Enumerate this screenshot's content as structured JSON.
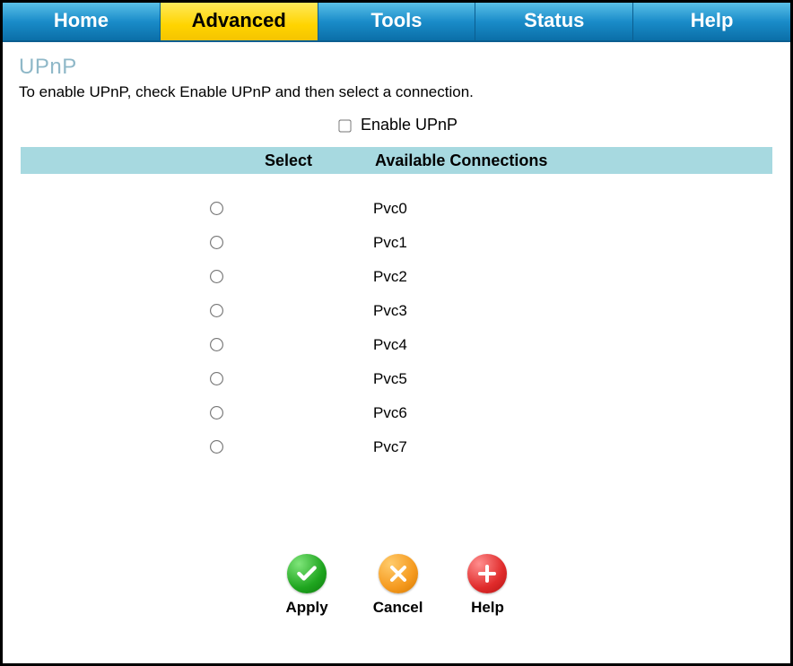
{
  "tabs": [
    {
      "label": "Home",
      "active": false
    },
    {
      "label": "Advanced",
      "active": true
    },
    {
      "label": "Tools",
      "active": false
    },
    {
      "label": "Status",
      "active": false
    },
    {
      "label": "Help",
      "active": false
    }
  ],
  "page": {
    "title": "UPnP",
    "description": "To enable UPnP, check Enable UPnP and then select a connection.",
    "enable_label": "Enable UPnP",
    "enable_checked": false
  },
  "table": {
    "header_select": "Select",
    "header_conn": "Available Connections",
    "rows": [
      {
        "name": "Pvc0",
        "selected": false
      },
      {
        "name": "Pvc1",
        "selected": false
      },
      {
        "name": "Pvc2",
        "selected": false
      },
      {
        "name": "Pvc3",
        "selected": false
      },
      {
        "name": "Pvc4",
        "selected": false
      },
      {
        "name": "Pvc5",
        "selected": false
      },
      {
        "name": "Pvc6",
        "selected": false
      },
      {
        "name": "Pvc7",
        "selected": false
      }
    ]
  },
  "buttons": {
    "apply": "Apply",
    "cancel": "Cancel",
    "help": "Help"
  }
}
